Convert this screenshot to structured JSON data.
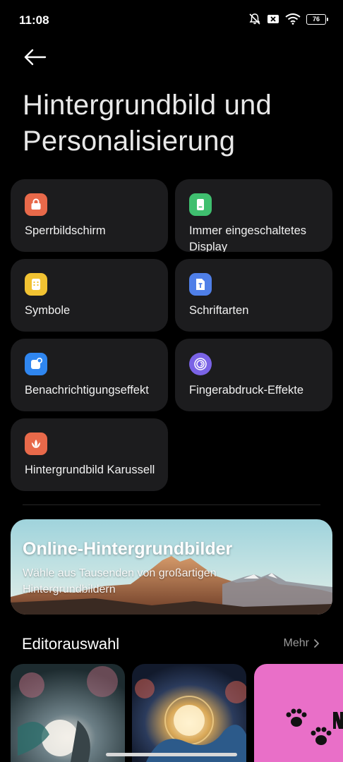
{
  "status": {
    "time": "11:08",
    "battery": "76"
  },
  "header": {
    "title": "Hintergrundbild und Personalisierung"
  },
  "tiles": [
    {
      "label": "Sperrbildschirm",
      "icon": "lock-screen-icon",
      "color": "#e8694a"
    },
    {
      "label": "Immer eingeschaltetes Display",
      "icon": "always-on-display-icon",
      "color": "#3fbf6f"
    },
    {
      "label": "Symbole",
      "icon": "app-icons-icon",
      "color": "#f1c232"
    },
    {
      "label": "Schriftarten",
      "icon": "fonts-icon",
      "color": "#4f7fe8"
    },
    {
      "label": "Benachrichtigungseffekt",
      "icon": "notification-effect-icon",
      "color": "#2f86f0"
    },
    {
      "label": "Fingerabdruck-Effekte",
      "icon": "fingerprint-icon",
      "color": "#7a63e6"
    },
    {
      "label": "Hintergrundbild Karussell",
      "icon": "wallpaper-carousel-icon",
      "color": "#e8694a"
    }
  ],
  "banner": {
    "title": "Online-Hintergrundbilder",
    "subtitle": "Wähle aus Tausenden von großartigen Hintergrundbildern"
  },
  "editors_choice": {
    "title": "Editorauswahl",
    "more": "Mehr"
  }
}
